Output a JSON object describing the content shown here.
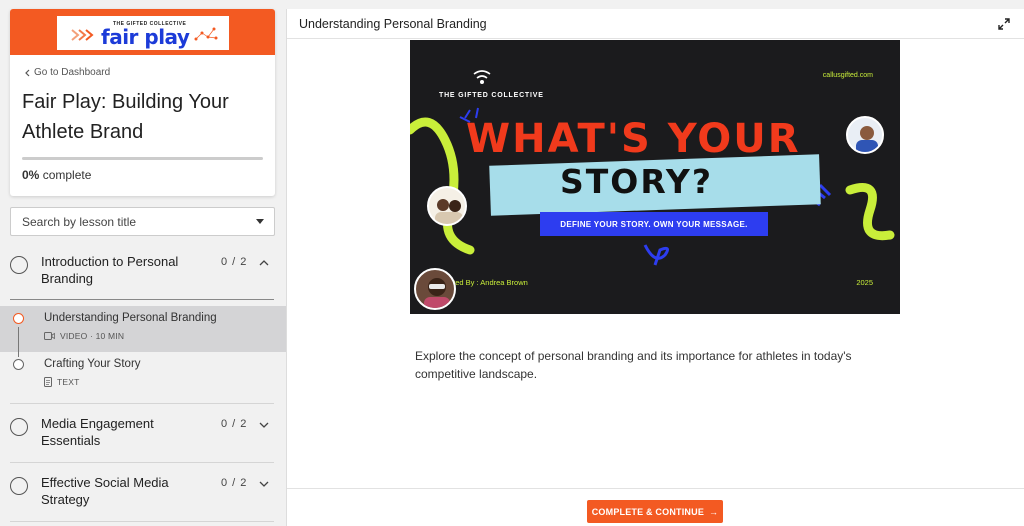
{
  "sidebar": {
    "logo": {
      "sub": "THE GIFTED COLLECTIVE",
      "main": "fair play"
    },
    "back_link": "Go to Dashboard",
    "course_title": "Fair Play: Building Your Athlete Brand",
    "progress": {
      "percent_label": "0%",
      "suffix": "complete",
      "fraction": 0
    },
    "search_placeholder": "Search by lesson title",
    "sections": [
      {
        "title": "Introduction to Personal Branding",
        "count": "0 / 2",
        "expanded": true,
        "lessons": [
          {
            "title": "Understanding Personal Branding",
            "meta": "VIDEO · 10 MIN",
            "icon": "video-icon",
            "active": true
          },
          {
            "title": "Crafting Your Story",
            "meta": "TEXT",
            "icon": "document-icon",
            "active": false
          }
        ]
      },
      {
        "title": "Media Engagement Essentials",
        "count": "0 / 2",
        "expanded": false
      },
      {
        "title": "Effective Social Media Strategy",
        "count": "0 / 2",
        "expanded": false
      }
    ]
  },
  "main": {
    "lesson_title": "Understanding Personal Branding",
    "video": {
      "brand": "THE GIFTED COLLECTIVE",
      "url": "callusgifted.com",
      "headline_1": "WHAT'S YOUR",
      "headline_2": "STORY?",
      "tagline": "DEFINE YOUR STORY. OWN YOUR MESSAGE.",
      "presented": "nted By : Andrea Brown",
      "year": "2025"
    },
    "description": "Explore the concept of personal branding and its importance for athletes in today's competitive landscape.",
    "cta_label": "COMPLETE & CONTINUE",
    "cta_arrow": "→"
  },
  "colors": {
    "accent": "#f35a22",
    "brand_blue": "#1c3bd8",
    "lime": "#c9ee3a"
  }
}
